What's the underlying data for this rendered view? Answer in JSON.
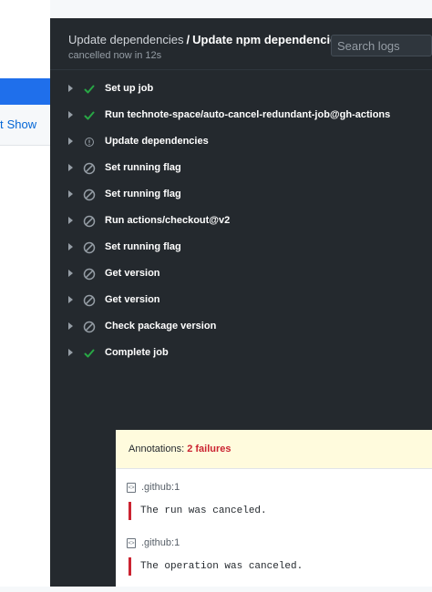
{
  "left": {
    "restart_fragment": "t",
    "show_link": "Show"
  },
  "log": {
    "workflow_name": "Update dependencies",
    "separator": "/",
    "job_name": "Update npm dependencies",
    "status_text": "cancelled now in 12s",
    "search_placeholder": "Search logs"
  },
  "steps": [
    {
      "label": "Set up job",
      "status": "success"
    },
    {
      "label": "Run technote-space/auto-cancel-redundant-job@gh-actions",
      "status": "success"
    },
    {
      "label": "Update dependencies",
      "status": "cancelled-info"
    },
    {
      "label": "Set running flag",
      "status": "skipped"
    },
    {
      "label": "Set running flag",
      "status": "skipped"
    },
    {
      "label": "Run actions/checkout@v2",
      "status": "skipped"
    },
    {
      "label": "Set running flag",
      "status": "skipped"
    },
    {
      "label": "Get version",
      "status": "skipped"
    },
    {
      "label": "Get version",
      "status": "skipped"
    },
    {
      "label": "Check package version",
      "status": "skipped"
    },
    {
      "label": "Complete job",
      "status": "success"
    }
  ],
  "annotations": {
    "label": "Annotations:",
    "count": "2 failures",
    "items": [
      {
        "file": ".github:1",
        "message": "The run was canceled."
      },
      {
        "file": ".github:1",
        "message": "The operation was canceled."
      }
    ]
  },
  "colors": {
    "success": "#28a745",
    "skipped": "#959da5",
    "failure": "#cb2431"
  }
}
